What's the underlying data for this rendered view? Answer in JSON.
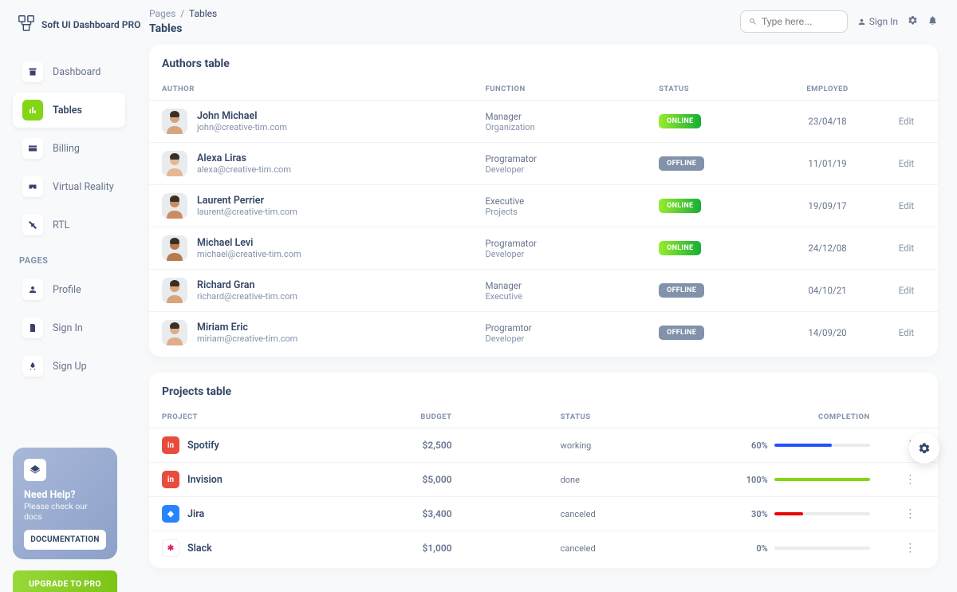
{
  "brand": "Soft UI Dashboard PRO",
  "nav": {
    "items": [
      {
        "label": "Dashboard",
        "icon": "shop"
      },
      {
        "label": "Tables",
        "icon": "chart"
      },
      {
        "label": "Billing",
        "icon": "card"
      },
      {
        "label": "Virtual Reality",
        "icon": "vr"
      },
      {
        "label": "RTL",
        "icon": "tools"
      }
    ],
    "pages_label": "PAGES",
    "pages": [
      {
        "label": "Profile",
        "icon": "user"
      },
      {
        "label": "Sign In",
        "icon": "doc"
      },
      {
        "label": "Sign Up",
        "icon": "rocket"
      }
    ]
  },
  "help": {
    "title": "Need Help?",
    "subtitle": "Please check our docs",
    "button": "DOCUMENTATION"
  },
  "upgrade_label": "UPGRADE TO PRO",
  "breadcrumb": {
    "root": "Pages",
    "current": "Tables"
  },
  "page_title": "Tables",
  "search_placeholder": "Type here...",
  "signin_label": "Sign In",
  "authors": {
    "title": "Authors table",
    "headers": {
      "author": "AUTHOR",
      "function": "FUNCTION",
      "status": "STATUS",
      "employed": "EMPLOYED"
    },
    "edit_label": "Edit",
    "rows": [
      {
        "name": "John Michael",
        "email": "john@creative-tim.com",
        "func": "Manager",
        "sub": "Organization",
        "status": "ONLINE",
        "date": "23/04/18",
        "skin": "#d9a47a"
      },
      {
        "name": "Alexa Liras",
        "email": "alexa@creative-tim.com",
        "func": "Programator",
        "sub": "Developer",
        "status": "OFFLINE",
        "date": "11/01/19",
        "skin": "#e6b894"
      },
      {
        "name": "Laurent Perrier",
        "email": "laurent@creative-tim.com",
        "func": "Executive",
        "sub": "Projects",
        "status": "ONLINE",
        "date": "19/09/17",
        "skin": "#c98d62"
      },
      {
        "name": "Michael Levi",
        "email": "michael@creative-tim.com",
        "func": "Programator",
        "sub": "Developer",
        "status": "ONLINE",
        "date": "24/12/08",
        "skin": "#b87a4f"
      },
      {
        "name": "Richard Gran",
        "email": "richard@creative-tim.com",
        "func": "Manager",
        "sub": "Executive",
        "status": "OFFLINE",
        "date": "04/10/21",
        "skin": "#d9a47a"
      },
      {
        "name": "Miriam Eric",
        "email": "miriam@creative-tim.com",
        "func": "Programtor",
        "sub": "Developer",
        "status": "OFFLINE",
        "date": "14/09/20",
        "skin": "#e0ad88"
      }
    ]
  },
  "projects": {
    "title": "Projects table",
    "headers": {
      "project": "PROJECT",
      "budget": "BUDGET",
      "status": "STATUS",
      "completion": "COMPLETION"
    },
    "rows": [
      {
        "name": "Spotify",
        "budget": "$2,500",
        "status": "working",
        "pct": 60,
        "bar_color": "#2152ff",
        "icon_bg": "#e84c3d",
        "icon_txt": "in"
      },
      {
        "name": "Invision",
        "budget": "$5,000",
        "status": "done",
        "pct": 100,
        "bar_color": "#82d616",
        "icon_bg": "#e84c3d",
        "icon_txt": "in"
      },
      {
        "name": "Jira",
        "budget": "$3,400",
        "status": "canceled",
        "pct": 30,
        "bar_color": "#ea0606",
        "icon_bg": "#2684ff",
        "icon_txt": "◆"
      },
      {
        "name": "Slack",
        "budget": "$1,000",
        "status": "canceled",
        "pct": 0,
        "bar_color": "#82d616",
        "icon_bg": "#ffffff",
        "icon_txt": "✱"
      }
    ]
  }
}
